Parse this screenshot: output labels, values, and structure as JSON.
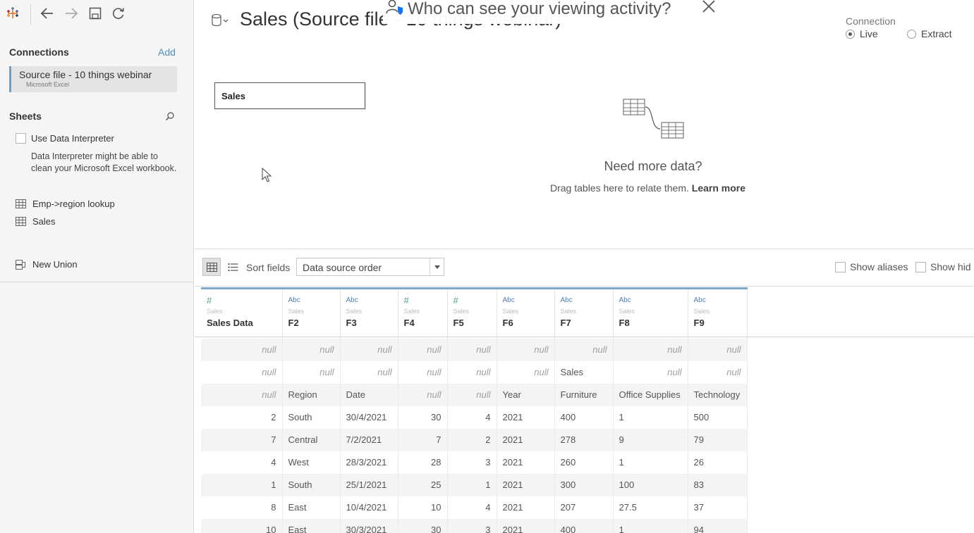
{
  "toolbar": {
    "logo_icon": "tableau-logo-icon",
    "back_icon": "back-arrow-icon",
    "forward_icon": "forward-arrow-icon",
    "save_icon": "save-icon",
    "refresh_icon": "refresh-icon"
  },
  "connections": {
    "title": "Connections",
    "add_label": "Add",
    "items": [
      {
        "name": "Source file - 10 things webinar",
        "type": "Microsoft Excel"
      }
    ]
  },
  "sheets": {
    "title": "Sheets",
    "use_interpreter_label": "Use Data Interpreter",
    "interpreter_desc": "Data Interpreter might be able to clean your Microsoft Excel workbook.",
    "items": [
      {
        "label": "Emp->region lookup"
      },
      {
        "label": "Sales"
      }
    ],
    "new_union_label": "New Union"
  },
  "canvas": {
    "datasource_title": "Sales (Source file - 10 things webinar)",
    "table_pill": "Sales",
    "need_more_title": "Need more data?",
    "need_more_sub": "Drag tables here to relate them.",
    "learn_more": "Learn more",
    "connection_label": "Connection",
    "live_label": "Live",
    "extract_label": "Extract",
    "connection_selected": "Live"
  },
  "banner": {
    "text": "Who can see your viewing activity?"
  },
  "grid_toolbar": {
    "sort_label": "Sort fields",
    "sort_value": "Data source order",
    "show_aliases": "Show aliases",
    "show_hidden": "Show hid"
  },
  "grid": {
    "columns": [
      {
        "type": "#",
        "source": "Sales",
        "name": "Sales Data",
        "kind": "num"
      },
      {
        "type": "Abc",
        "source": "Sales",
        "name": "F2",
        "kind": "abc"
      },
      {
        "type": "Abc",
        "source": "Sales",
        "name": "F3",
        "kind": "abc"
      },
      {
        "type": "#",
        "source": "Sales",
        "name": "F4",
        "kind": "num"
      },
      {
        "type": "#",
        "source": "Sales",
        "name": "F5",
        "kind": "num"
      },
      {
        "type": "Abc",
        "source": "Sales",
        "name": "F6",
        "kind": "abc"
      },
      {
        "type": "Abc",
        "source": "Sales",
        "name": "F7",
        "kind": "abc"
      },
      {
        "type": "Abc",
        "source": "Sales",
        "name": "F8",
        "kind": "abc"
      },
      {
        "type": "Abc",
        "source": "Sales",
        "name": "F9",
        "kind": "abc"
      }
    ],
    "rows": [
      [
        "null",
        "null",
        "null",
        "null",
        "null",
        "null",
        "null",
        "null",
        "null"
      ],
      [
        "null",
        "null",
        "null",
        "null",
        "null",
        "null",
        "Sales",
        "null",
        "null"
      ],
      [
        "null",
        "Region",
        "Date",
        "null",
        "null",
        "Year",
        "Furniture",
        "Office Supplies",
        "Technology"
      ],
      [
        "2",
        "South",
        "30/4/2021",
        "30",
        "4",
        "2021",
        "400",
        "1",
        "500"
      ],
      [
        "7",
        "Central",
        "7/2/2021",
        "7",
        "2",
        "2021",
        "278",
        "9",
        "79"
      ],
      [
        "4",
        "West",
        "28/3/2021",
        "28",
        "3",
        "2021",
        "260",
        "1",
        "26"
      ],
      [
        "1",
        "South",
        "25/1/2021",
        "25",
        "1",
        "2021",
        "300",
        "100",
        "83"
      ],
      [
        "8",
        "East",
        "10/4/2021",
        "10",
        "4",
        "2021",
        "207",
        "27.5",
        "37"
      ],
      [
        "10",
        "East",
        "30/3/2021",
        "30",
        "3",
        "2021",
        "400",
        "1",
        "94"
      ]
    ]
  }
}
